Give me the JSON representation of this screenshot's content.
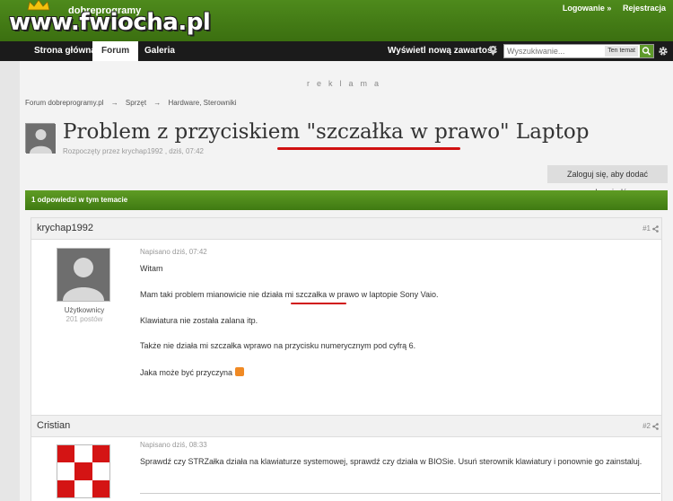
{
  "header": {
    "site_small": "dobreprogramy",
    "logo_text": "www.fwiocha.pl",
    "login": "Logowanie »",
    "register": "Rejestracja"
  },
  "nav": {
    "home": "Strona główna",
    "forum": "Forum",
    "gallery": "Galeria",
    "show_new": "Wyświetl nową zawartość",
    "search_placeholder": "Wyszukiwanie...",
    "search_scope": "Ten temat"
  },
  "ad_label": "reklama",
  "breadcrumb": [
    "Forum dobreprogramy.pl",
    "→",
    "Sprzęt",
    "→",
    "Hardware, Sterowniki"
  ],
  "topic": {
    "title": "Problem z przyciskiem \"szczałka w prawo\" Laptop",
    "meta": "Rozpoczęty przez krychap1992 , dziś, 07:42",
    "reply_button": "Zaloguj się, aby dodać odpowiedź",
    "answers_bar": "1 odpowiedzi w tym temacie"
  },
  "posts": [
    {
      "author": "krychap1992",
      "number": "#1",
      "group": "Użytkownicy",
      "post_count": "201 postów",
      "date": "Napisano dziś, 07:42",
      "lines": [
        "Witam",
        "Mam taki problem  mianowicie nie działa mi szczałka w prawo w laptopie Sony Vaio.",
        "Klawiatura nie została zalana itp.",
        "Także nie działa mi szczałka wprawo na przycisku numerycznym pod cyfrą 6.",
        "Jaka może być przyczyna"
      ]
    },
    {
      "author": "Cristian",
      "number": "#2",
      "date": "Napisano dziś, 08:33",
      "lines": [
        "Sprawdź czy STRZałka działa na klawiaturze systemowej, sprawdź czy działa w BIOSie. Usuń sterownik klawiatury i ponownie go zainstaluj."
      ]
    }
  ],
  "colors": {
    "banner_green": "#4e8a1c",
    "nav_black": "#1b1b1b",
    "answers_green": "#5f9c24",
    "underline_red": "#d01010"
  }
}
